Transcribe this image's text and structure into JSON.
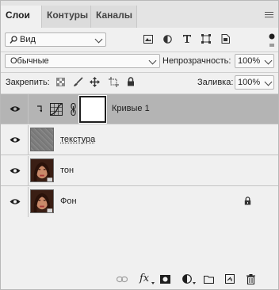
{
  "tabs": [
    {
      "label": "Слои"
    },
    {
      "label": "Контуры"
    },
    {
      "label": "Каналы"
    }
  ],
  "filter": {
    "kind": "Вид"
  },
  "blend": {
    "mode": "Обычные",
    "opacity_label": "Непрозрачность:",
    "opacity_value": "100%"
  },
  "lock": {
    "label": "Закрепить:",
    "fill_label": "Заливка:",
    "fill_value": "100%"
  },
  "layers": [
    {
      "name": "Кривые 1",
      "selected": true
    },
    {
      "name": "текстура"
    },
    {
      "name": "тон"
    },
    {
      "name": "Фон",
      "locked": true
    }
  ],
  "bottom": {
    "fx_label": "fx"
  }
}
